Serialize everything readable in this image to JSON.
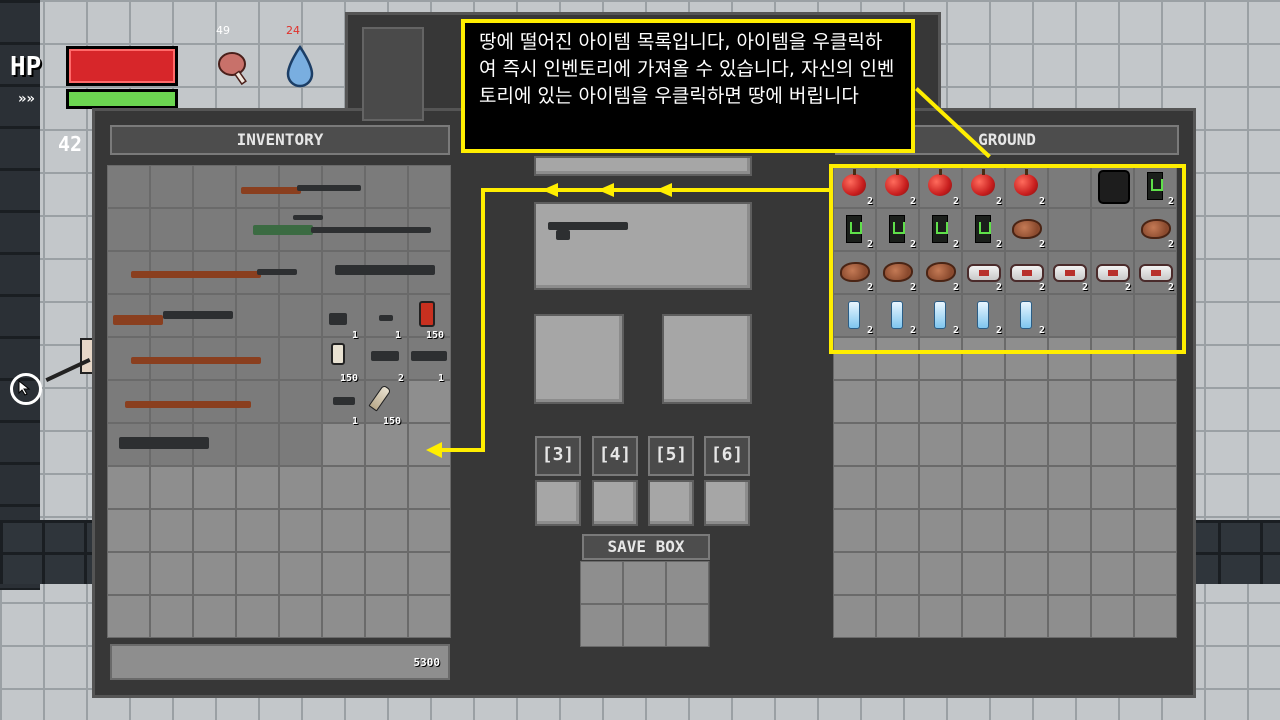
{
  "hud": {
    "hp_label": "HP",
    "stamina_icon": "»»",
    "food_value": "49",
    "water_value": "24",
    "level": "42",
    "hp_color": "#d7262a",
    "stamina_color": "#6cd651"
  },
  "inventory": {
    "title": "INVENTORY",
    "money": "5300",
    "counts": {
      "a": "1",
      "b": "1",
      "c": "150",
      "d": "150",
      "e": "2",
      "f": "1",
      "g": "1",
      "h": "150"
    }
  },
  "ground": {
    "title": "GROUND",
    "stack_count": "2"
  },
  "equipment": {
    "hotkeys": [
      "[3]",
      "[4]",
      "[5]",
      "[6]"
    ]
  },
  "save_box": {
    "title": "SAVE BOX"
  },
  "tooltip": {
    "text": "땅에 떨어진 아이템 목록입니다, 아이템을 우클릭하여 즉시 인벤토리에 가져올 수 있습니다, 자신의 인벤토리에 있는 아이템을 우클릭하면 땅에 버립니다",
    "accent": "#ffee00"
  }
}
